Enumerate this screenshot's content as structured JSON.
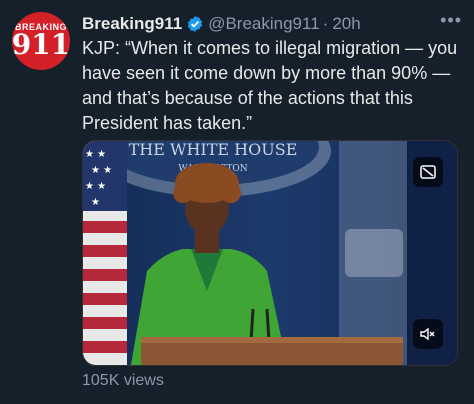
{
  "account": {
    "display_name": "Breaking911",
    "handle": "@Breaking911",
    "separator": "·",
    "time": "20h",
    "avatar_top_text": "BREAKING",
    "avatar_number": "911"
  },
  "tweet": {
    "text": "KJP: “When it comes to illegal migration — you have seen it come down by more than 90% — and that’s because of the actions that this President has taken.”"
  },
  "media": {
    "backdrop_line1": "THE WHITE HOUSE",
    "backdrop_line2": "WASHINGTON"
  },
  "stats": {
    "views": "105K views"
  },
  "icons": {
    "verified": "verified-badge-icon",
    "more": "more-options-icon",
    "captions": "captions-icon",
    "mute": "mute-icon"
  },
  "colors": {
    "background": "#15202b",
    "verified": "#1d9bf0",
    "secondary_text": "#8b98a5"
  }
}
